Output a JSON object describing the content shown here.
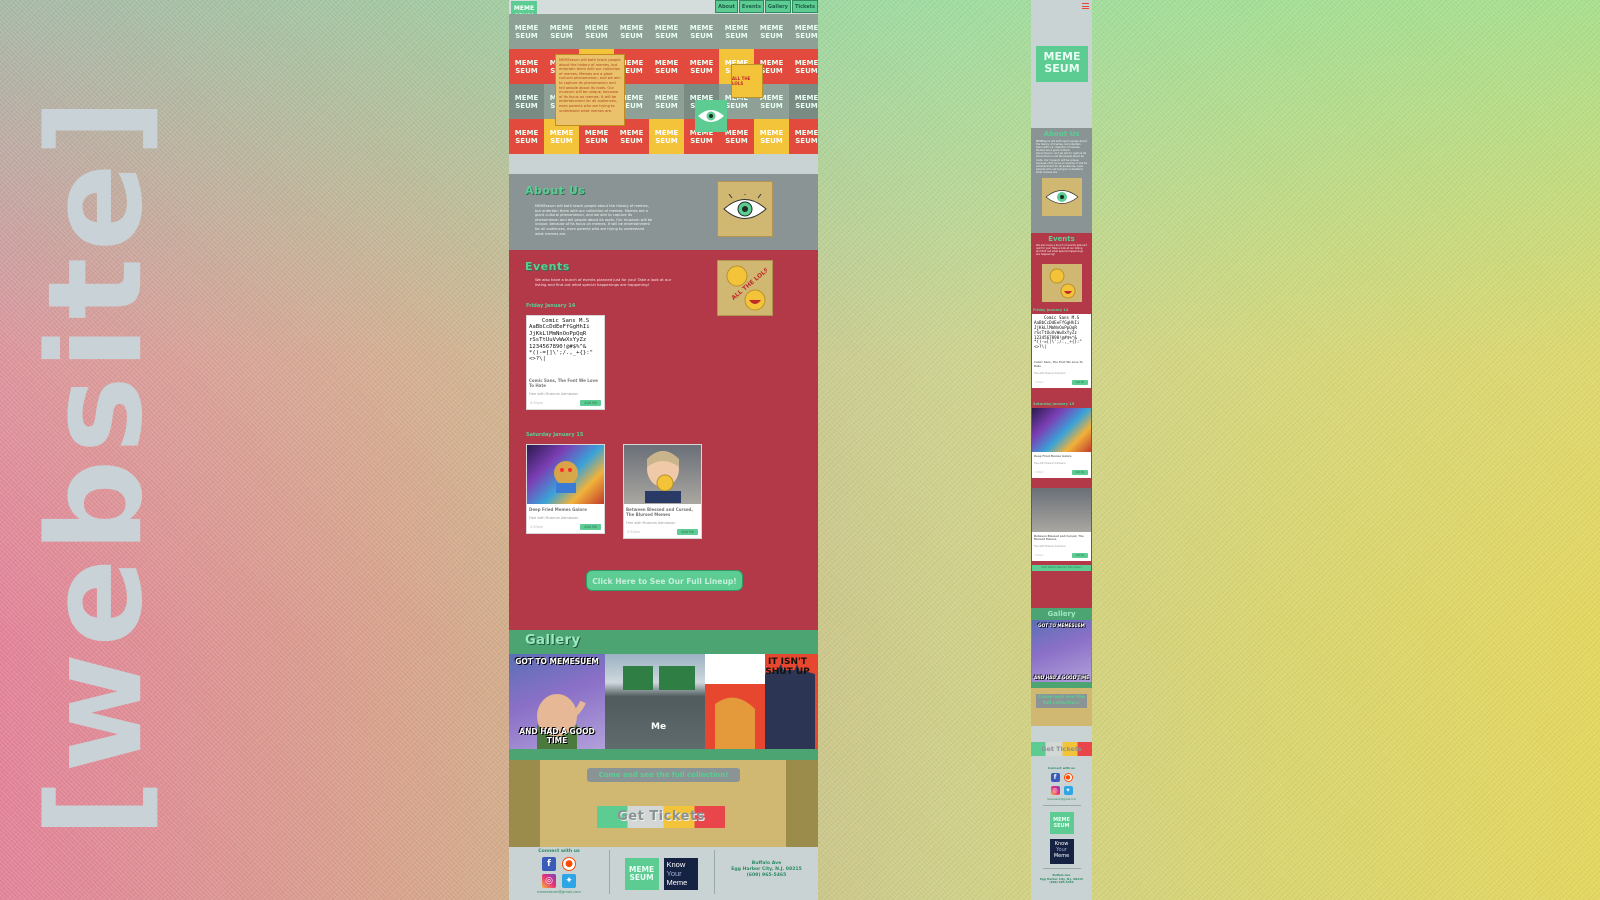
{
  "presentation": {
    "vertical_title": "[website]"
  },
  "desktop": {
    "brand": "MEME SEUM",
    "nav": [
      "About",
      "Events",
      "Gallery",
      "Tickets"
    ],
    "about": {
      "title": "About Us",
      "text": "MEMEseum will both teach people about the history of memes, but entertain them with our collection of memes. Memes are a giant cultural phenomenon, and we aim to capture its phenomenon and tell people about its roots. Our museum will be unique, because of its focus on memes. It will be entertainment for all audiences, even parents who are trying to understand what memes are."
    },
    "events": {
      "title": "Events",
      "text": "We also have a bunch of events planned just for you! Take a look at our listing and find out what special happenings are happening!",
      "sticker": "ALL THE LOLS",
      "days": [
        {
          "label": "Friday January 14",
          "cards": [
            {
              "font_sample_title": "Comic Sans M.S",
              "font_sample_lines": [
                "AaBbCcDdEeFfGgHhIi",
                "JjKkLlMmNnOoPpQqR",
                "rSsTtUuVvWwXxYyZz",
                "1234567890!@#$%^&",
                "*()-=[]\\';/.,_+{}:\"<>?\\|"
              ],
              "title": "Comic Sans, The Font We Love To Hate",
              "note": "Free with Museum Admission",
              "time": "4:30pm",
              "button": "Add Me"
            }
          ]
        },
        {
          "label": "Saturday January 15",
          "cards": [
            {
              "title": "Deep Fried Memes Galore",
              "note": "Free with Museum Admission",
              "time": "2:30pm",
              "button": "Add Me"
            },
            {
              "title": "Between Blessed and Cursed, The Blursed Memes",
              "note": "Free with Museum Admission",
              "time": "5:30pm",
              "button": "Add Me"
            }
          ]
        }
      ],
      "lineup_button": "Click Here to See Our Full Lineup!"
    },
    "gallery": {
      "title": "Gallery",
      "items": [
        {
          "top": "GOT TO MEMESUEM",
          "bottom": "AND HAD A GOOD TIME"
        },
        {
          "caption": "Me"
        },
        {
          "top": "IT ISN'T SHUT UP"
        }
      ]
    },
    "collection_button": "Come and see the full collection!",
    "tickets_button": "Get Tickets",
    "footer": {
      "connect_label": "Connect with us",
      "email": "memeseum@gmail.com",
      "kym_line1": "Know",
      "kym_line2": "Your",
      "kym_line3": "Meme",
      "address_line1": "Buffalo Ave",
      "address_line2": "Egg Harbor City, N.J. 08215",
      "address_line3": "(609) 965-5465"
    }
  },
  "mobile": {
    "about_title": "About Us",
    "events_title": "Events",
    "day1": "Friday January 14",
    "day2": "Saturday January 15",
    "collection_button": "Come and see the full collection!",
    "tickets_button": "Get Tickets"
  },
  "colors": {
    "green": "#5ccc93",
    "red": "#b33948",
    "gray": "#8a9494",
    "tan": "#d0b872",
    "yellow": "#f3c33a"
  }
}
